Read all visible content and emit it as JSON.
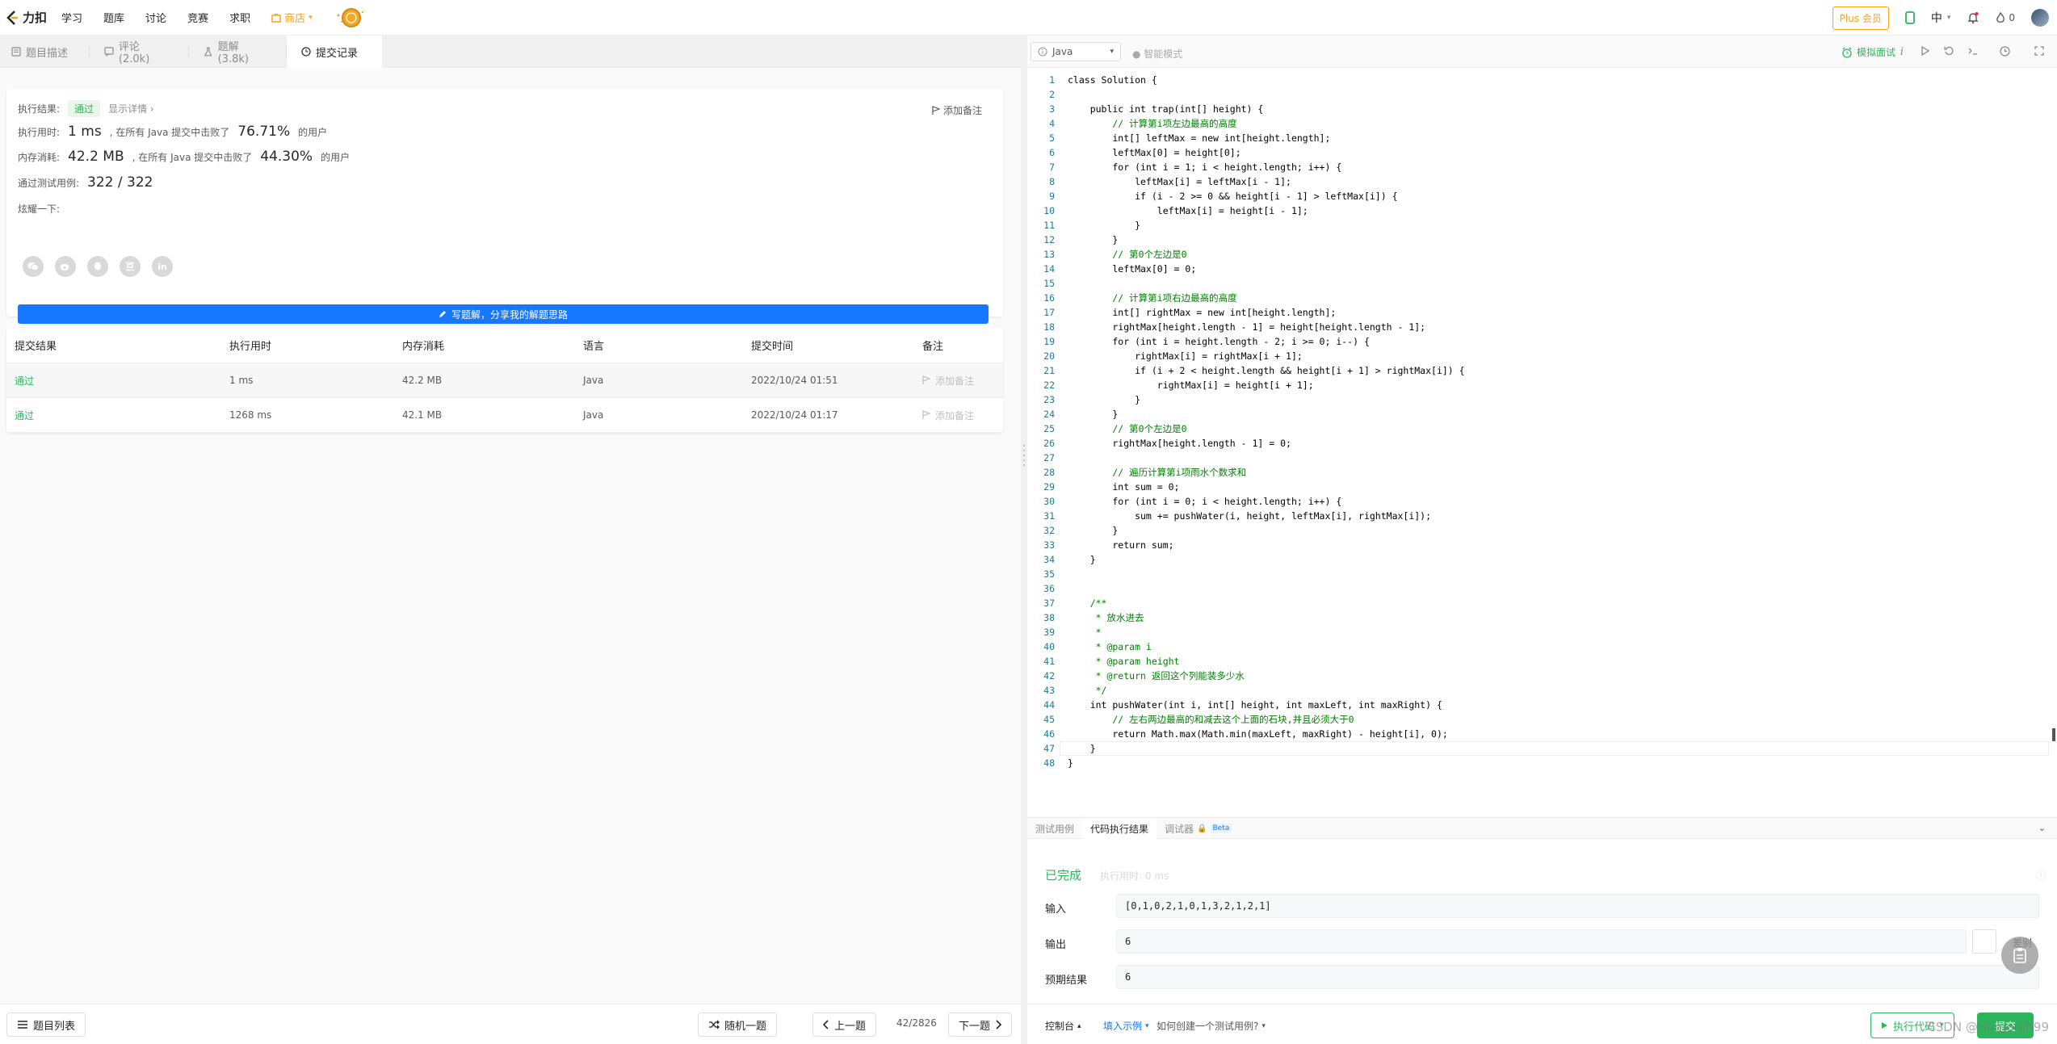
{
  "nav": {
    "logo": "力扣",
    "items": [
      "学习",
      "题库",
      "讨论",
      "竞赛",
      "求职"
    ],
    "store": "商店",
    "plus": "Plus 会员",
    "lang": "中",
    "fire_count": "0"
  },
  "tabs": [
    {
      "label": "题目描述"
    },
    {
      "label": "评论 (2.0k)"
    },
    {
      "label": "题解 (3.8k)"
    },
    {
      "label": "提交记录"
    }
  ],
  "result": {
    "status_label": "执行结果:",
    "status": "通过",
    "detail": "显示详情 ›",
    "add_note": "添加备注",
    "time_label": "执行用时:",
    "time_value": "1 ms",
    "time_desc": ", 在所有 Java 提交中击败了",
    "time_pct": "76.71%",
    "user_suffix": "的用户",
    "mem_label": "内存消耗:",
    "mem_value": "42.2 MB",
    "mem_desc": ", 在所有 Java 提交中击败了",
    "mem_pct": "44.30%",
    "tests_label": "通过测试用例:",
    "tests_value": "322 / 322",
    "share_label": "炫耀一下:",
    "write_btn": "写题解，分享我的解题思路"
  },
  "submissions": {
    "headers": [
      "提交结果",
      "执行用时",
      "内存消耗",
      "语言",
      "提交时间",
      "备注"
    ],
    "rows": [
      {
        "status": "通过",
        "time": "1 ms",
        "memory": "42.2 MB",
        "lang": "Java",
        "submitted": "2022/10/24 01:51",
        "note": "添加备注"
      },
      {
        "status": "通过",
        "time": "1268 ms",
        "memory": "42.1 MB",
        "lang": "Java",
        "submitted": "2022/10/24 01:17",
        "note": "添加备注"
      }
    ]
  },
  "bottom_left": {
    "list": "题目列表",
    "random": "随机一题",
    "prev": "上一题",
    "page": "42/2826",
    "next": "下一题"
  },
  "editor": {
    "language": "Java",
    "smart_mode": "智能模式",
    "mock": "模拟面试",
    "lines": [
      "class Solution {",
      "",
      "    public int trap(int[] height) {",
      "        // 计算第i项左边最高的高度",
      "        int[] leftMax = new int[height.length];",
      "        leftMax[0] = height[0];",
      "        for (int i = 1; i < height.length; i++) {",
      "            leftMax[i] = leftMax[i - 1];",
      "            if (i - 2 >= 0 && height[i - 1] > leftMax[i]) {",
      "                leftMax[i] = height[i - 1];",
      "            }",
      "        }",
      "        // 第0个左边是0",
      "        leftMax[0] = 0;",
      "",
      "        // 计算第i项右边最高的高度",
      "        int[] rightMax = new int[height.length];",
      "        rightMax[height.length - 1] = height[height.length - 1];",
      "        for (int i = height.length - 2; i >= 0; i--) {",
      "            rightMax[i] = rightMax[i + 1];",
      "            if (i + 2 < height.length && height[i + 1] > rightMax[i]) {",
      "                rightMax[i] = height[i + 1];",
      "            }",
      "        }",
      "        // 第0个左边是0",
      "        rightMax[height.length - 1] = 0;",
      "",
      "        // 遍历计算第i项雨水个数求和",
      "        int sum = 0;",
      "        for (int i = 0; i < height.length; i++) {",
      "            sum += pushWater(i, height, leftMax[i], rightMax[i]);",
      "        }",
      "        return sum;",
      "    }",
      "",
      "",
      "    /**",
      "     * 放水进去",
      "     *",
      "     * @param i",
      "     * @param height",
      "     * @return 返回这个列能装多少水",
      "     */",
      "    int pushWater(int i, int[] height, int maxLeft, int maxRight) {",
      "        // 左右两边最高的和减去这个上面的石块,并且必须大于0",
      "        return Math.max(Math.min(maxLeft, maxRight) - height[i], 0);",
      "    }",
      "}"
    ]
  },
  "console": {
    "tabs": [
      "测试用例",
      "代码执行结果",
      "调试器"
    ],
    "beta": "Beta",
    "done": "已完成",
    "exec_time": "执行用时: 0 ms",
    "input_label": "输入",
    "input": "[0,1,0,2,1,0,1,3,2,1,2,1]",
    "output_label": "输出",
    "output": "6",
    "expected_label": "预期结果",
    "expected": "6",
    "diff": "差别"
  },
  "bottom_right": {
    "console": "控制台",
    "fill_example": "填入示例",
    "how_to": "如何创建一个测试用例?",
    "run": "执行代码",
    "submit": "提交"
  },
  "watermark": "CSDN @Humoroh99"
}
